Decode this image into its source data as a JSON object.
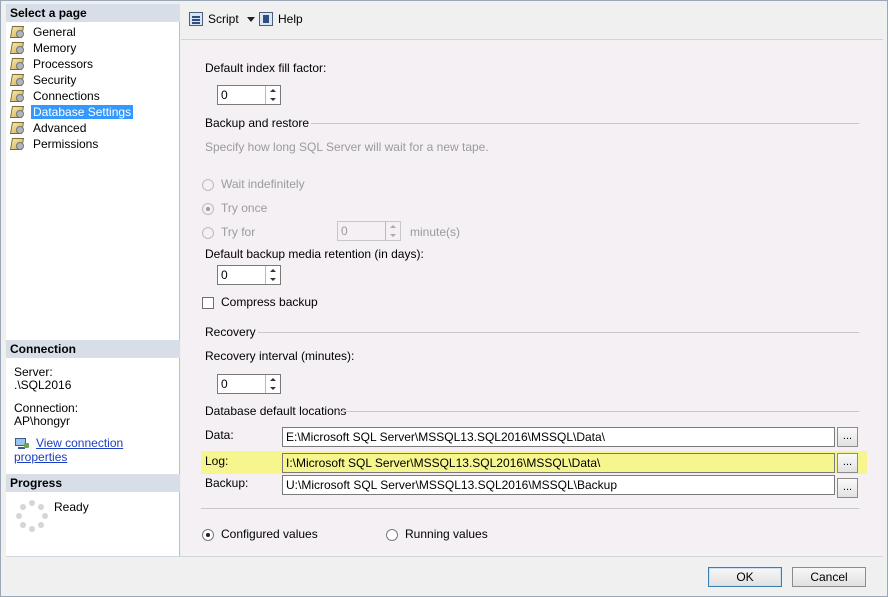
{
  "left": {
    "select_page_header": "Select a page",
    "pages": [
      {
        "label": "General",
        "selected": false
      },
      {
        "label": "Memory",
        "selected": false
      },
      {
        "label": "Processors",
        "selected": false
      },
      {
        "label": "Security",
        "selected": false
      },
      {
        "label": "Connections",
        "selected": false
      },
      {
        "label": "Database Settings",
        "selected": true
      },
      {
        "label": "Advanced",
        "selected": false
      },
      {
        "label": "Permissions",
        "selected": false
      }
    ],
    "connection_header": "Connection",
    "server_label": "Server:",
    "server_value": ".\\SQL2016",
    "connection_label": "Connection:",
    "connection_value": "AP\\hongyr",
    "view_props_link": "View connection properties",
    "progress_header": "Progress",
    "progress_status": "Ready"
  },
  "toolbar": {
    "script_label": "Script",
    "help_label": "Help"
  },
  "settings": {
    "fill_factor_label": "Default index fill factor:",
    "fill_factor_value": "0",
    "backup_restore_group": "Backup and restore",
    "tape_wait_desc": "Specify how long SQL Server will wait for a new tape.",
    "wait_indefinitely_label": "Wait indefinitely",
    "try_once_label": "Try once",
    "try_for_label": "Try for",
    "try_for_value": "0",
    "minutes_label": "minute(s)",
    "retention_label": "Default backup media retention (in days):",
    "retention_value": "0",
    "compress_backup_label": "Compress backup",
    "recovery_group": "Recovery",
    "recovery_interval_label": "Recovery interval (minutes):",
    "recovery_interval_value": "0",
    "locations_group": "Database default locations",
    "data_label": "Data:",
    "data_path": "E:\\Microsoft SQL Server\\MSSQL13.SQL2016\\MSSQL\\Data\\",
    "log_label": "Log:",
    "log_path": "I:\\Microsoft SQL Server\\MSSQL13.SQL2016\\MSSQL\\Data\\",
    "backup_label": "Backup:",
    "backup_path": "U:\\Microsoft SQL Server\\MSSQL13.SQL2016\\MSSQL\\Backup",
    "browse_label": "...",
    "configured_values_label": "Configured values",
    "running_values_label": "Running values"
  },
  "footer": {
    "ok_label": "OK",
    "cancel_label": "Cancel"
  },
  "colors": {
    "selection": "#3399ff",
    "highlight": "#f6f58e",
    "link": "#1a3fbf"
  }
}
